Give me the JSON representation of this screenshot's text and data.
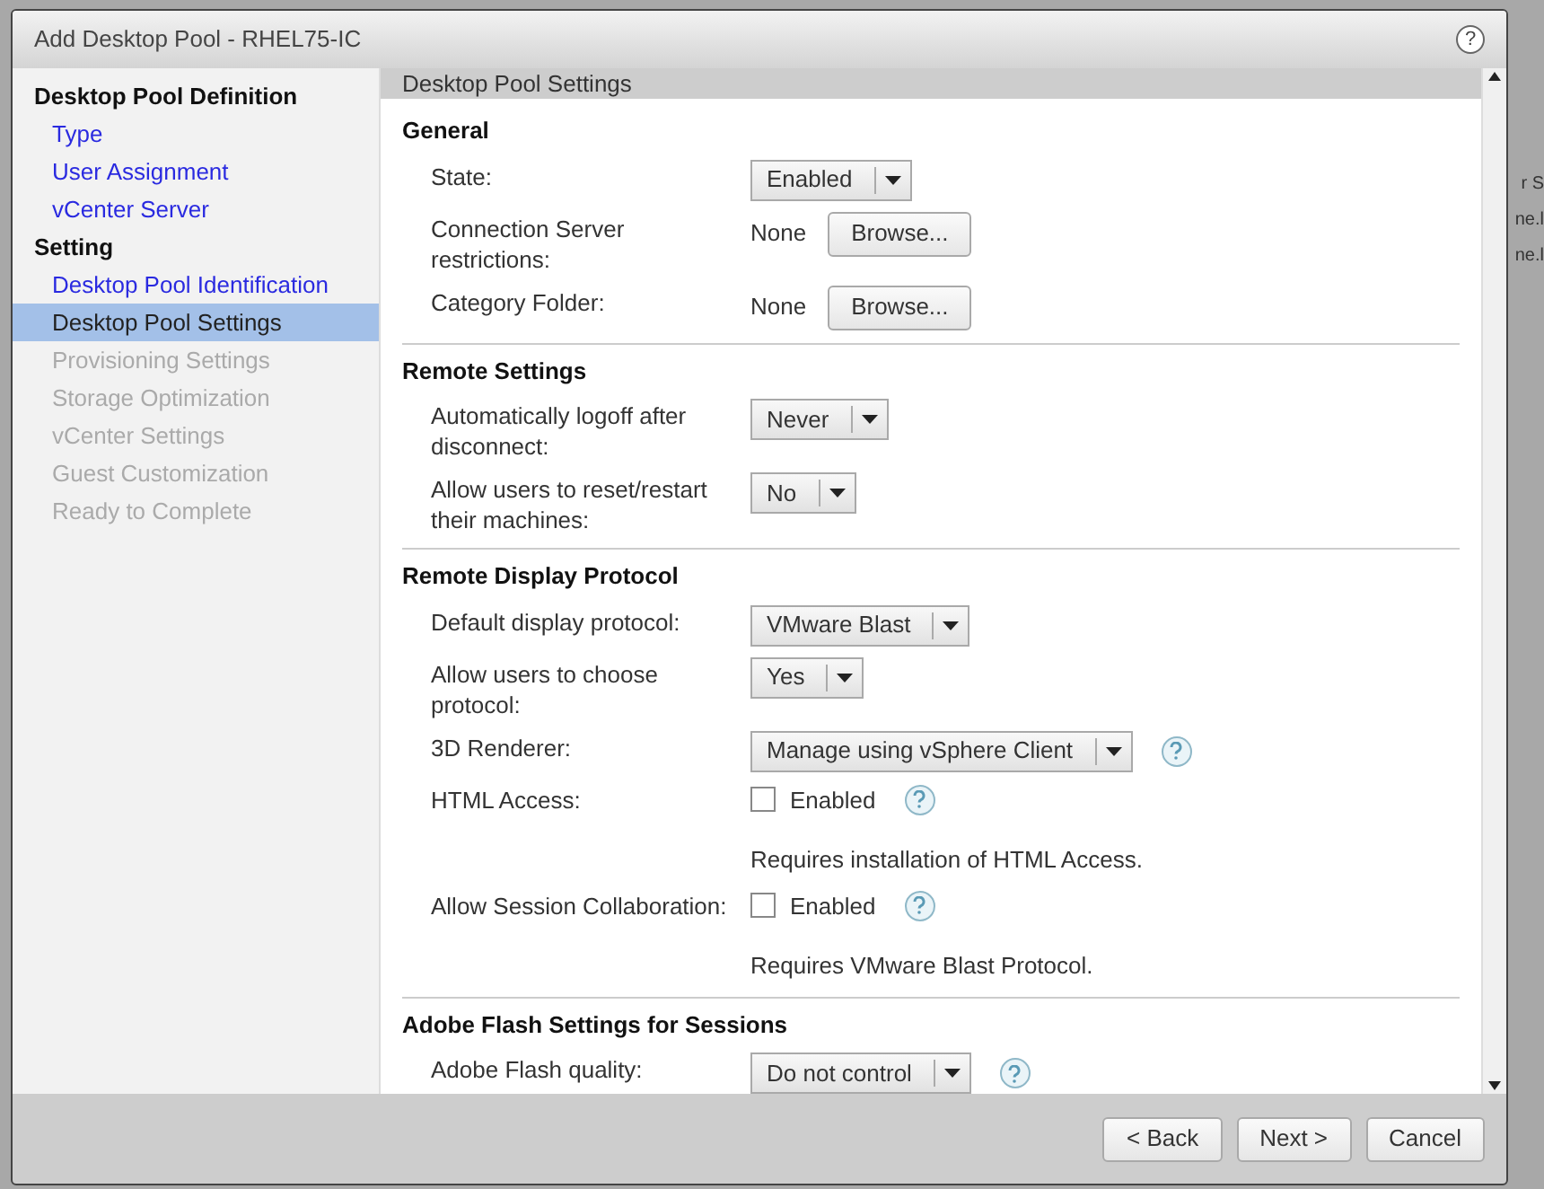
{
  "background_fragments": [
    "r S",
    "ne.l",
    "ne.l"
  ],
  "window": {
    "title": "Add Desktop Pool - RHEL75-IC",
    "help": "?"
  },
  "sidebar": {
    "items": [
      {
        "kind": "heading",
        "label": "Desktop Pool Definition"
      },
      {
        "kind": "link",
        "label": "Type",
        "selected": false,
        "disabled": false
      },
      {
        "kind": "link",
        "label": "User Assignment",
        "selected": false,
        "disabled": false
      },
      {
        "kind": "link",
        "label": "vCenter Server",
        "selected": false,
        "disabled": false
      },
      {
        "kind": "heading",
        "label": "Setting"
      },
      {
        "kind": "link",
        "label": "Desktop Pool Identification",
        "selected": false,
        "disabled": false
      },
      {
        "kind": "link",
        "label": "Desktop Pool Settings",
        "selected": true,
        "disabled": false
      },
      {
        "kind": "link",
        "label": "Provisioning Settings",
        "selected": false,
        "disabled": true
      },
      {
        "kind": "link",
        "label": "Storage Optimization",
        "selected": false,
        "disabled": true
      },
      {
        "kind": "link",
        "label": "vCenter Settings",
        "selected": false,
        "disabled": true
      },
      {
        "kind": "link",
        "label": "Guest Customization",
        "selected": false,
        "disabled": true
      },
      {
        "kind": "link",
        "label": "Ready to Complete",
        "selected": false,
        "disabled": true
      }
    ]
  },
  "panel_title": "Desktop Pool Settings",
  "sections": [
    {
      "title": "General",
      "rows": [
        {
          "kind": "select",
          "label": "State:",
          "value": "Enabled",
          "help": false
        },
        {
          "kind": "browse",
          "label": "Connection Server restrictions:",
          "value": "None",
          "button": "Browse..."
        },
        {
          "kind": "browse",
          "label": "Category Folder:",
          "value": "None",
          "button": "Browse..."
        }
      ]
    },
    {
      "title": "Remote Settings",
      "rows": [
        {
          "kind": "select",
          "label": "Automatically logoff after disconnect:",
          "value": "Never",
          "help": false
        },
        {
          "kind": "select",
          "label": "Allow users to reset/restart their machines:",
          "value": "No",
          "help": false
        }
      ]
    },
    {
      "title": "Remote Display Protocol",
      "rows": [
        {
          "kind": "select",
          "label": "Default display protocol:",
          "value": "VMware Blast",
          "help": false
        },
        {
          "kind": "select",
          "label": "Allow users to choose protocol:",
          "value": "Yes",
          "help": false
        },
        {
          "kind": "select",
          "label": "3D Renderer:",
          "value": "Manage using vSphere Client",
          "help": true
        },
        {
          "kind": "checkbox",
          "label": "HTML Access:",
          "option": "Enabled",
          "checked": false,
          "help": true,
          "note": "Requires installation of HTML Access."
        },
        {
          "kind": "checkbox",
          "label": "Allow Session Collaboration:",
          "option": "Enabled",
          "checked": false,
          "help": true,
          "note": "Requires VMware Blast Protocol."
        }
      ]
    },
    {
      "title": "Adobe Flash Settings for Sessions",
      "rows": [
        {
          "kind": "select",
          "label": "Adobe Flash quality:",
          "value": "Do not control",
          "help": true
        }
      ]
    }
  ],
  "buttons": [
    "< Back",
    "Next >",
    "Cancel"
  ]
}
